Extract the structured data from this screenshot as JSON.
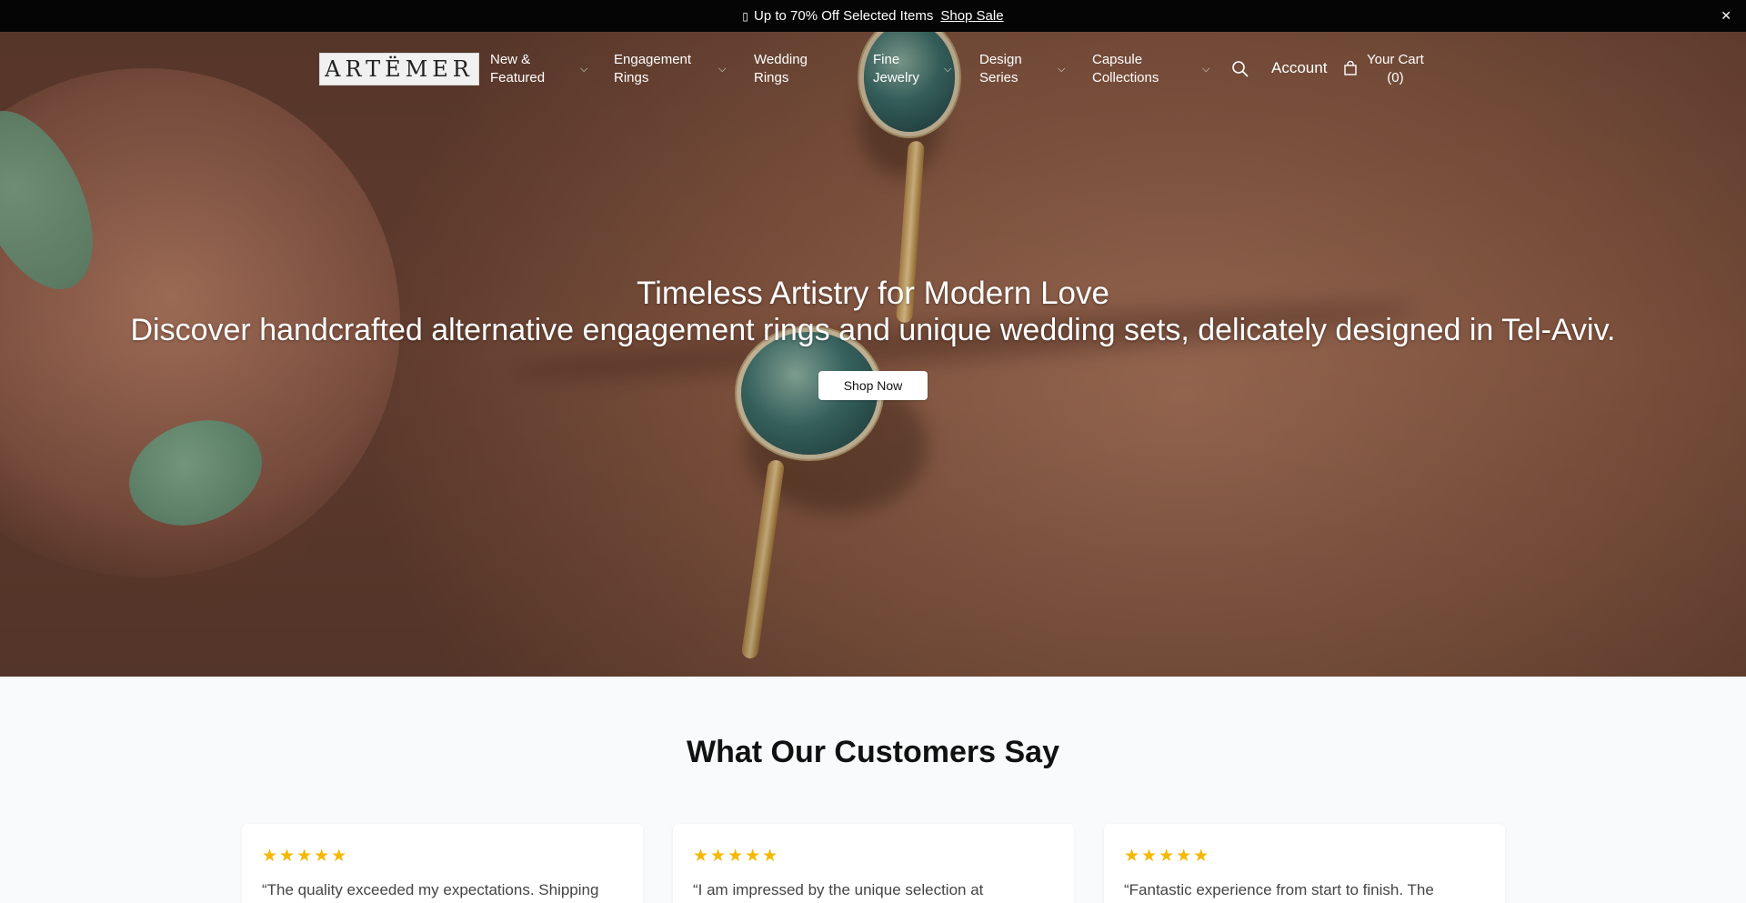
{
  "announcement": {
    "icon": "gift-icon",
    "text": "Up to 70% Off Selected Items",
    "link": "Shop Sale",
    "close_icon": "✕"
  },
  "brand": {
    "logo_text": "ARTËMER"
  },
  "nav": {
    "items": [
      {
        "line1": "New &",
        "line2": "Featured",
        "dropdown": true
      },
      {
        "line1": "Engagement",
        "line2": "Rings",
        "dropdown": true
      },
      {
        "line1": "Wedding",
        "line2": "Rings",
        "dropdown": false
      },
      {
        "line1": "Fine",
        "line2": "Jewelry",
        "dropdown": true
      },
      {
        "line1": "Design",
        "line2": "Series",
        "dropdown": true
      },
      {
        "line1": "Capsule",
        "line2": "Collections",
        "dropdown": true
      }
    ],
    "account": "Account",
    "cart_line1": "Your Cart",
    "cart_line2": "(0)"
  },
  "hero": {
    "title": "Timeless Artistry for Modern Love",
    "subtitle": "Discover handcrafted alternative engagement rings and unique wedding sets, delicately designed in Tel-Aviv.",
    "cta": "Shop Now"
  },
  "reviews": {
    "title": "What Our Customers Say",
    "rating_text": "★★★★★",
    "items": [
      {
        "quote": "“The quality exceeded my expectations. Shipping"
      },
      {
        "quote": "“I am impressed by the unique selection at"
      },
      {
        "quote": "“Fantastic experience from start to finish. The"
      }
    ]
  },
  "colors": {
    "announce_bg": "#050505",
    "star": "#f5b700",
    "page_bg": "#f9fafb"
  }
}
